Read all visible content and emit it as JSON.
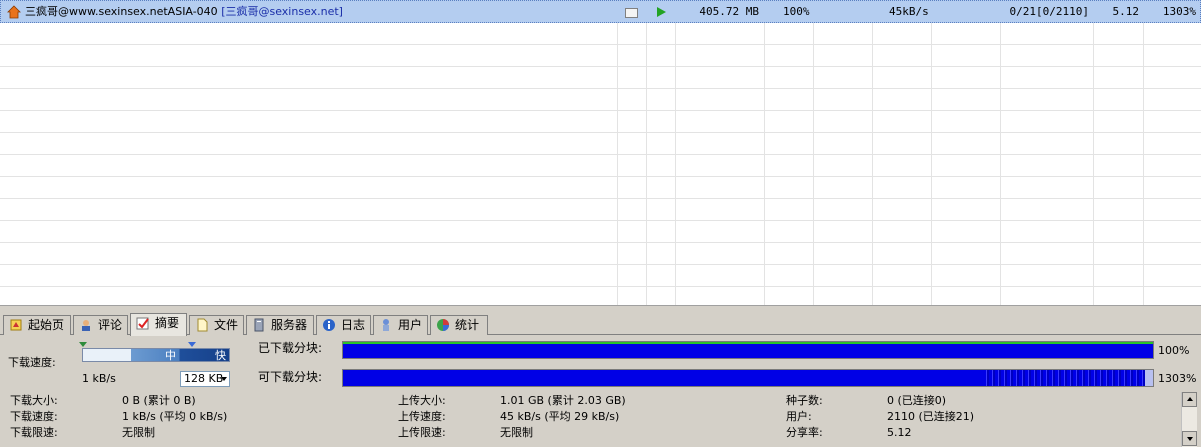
{
  "task": {
    "name": "三疯哥@www.sexinsex.netASIA-040",
    "tag": "[三疯哥@sexinsex.net]",
    "size": "405.72 MB",
    "progress": "100%",
    "speed": "45kB/s",
    "sources": "0/21[0/2110]",
    "ratio": "5.12",
    "percent": "1303%"
  },
  "tabs": [
    "起始页",
    "评论",
    "摘要",
    "文件",
    "服务器",
    "日志",
    "用户",
    "统计"
  ],
  "active_tab": "摘要",
  "summary": {
    "download_speed_label": "下载速度:",
    "speed_mid": "中",
    "speed_fast": "快",
    "current_speed": "1 kB/s",
    "limit_select": "128 KB",
    "downloaded_blocks_label": "已下载分块:",
    "downloaded_pct": "100%",
    "available_blocks_label": "可下载分块:",
    "available_pct": "1303%"
  },
  "stats": {
    "col1": [
      {
        "label": "下载大小:",
        "value": "0 B (累计 0 B)"
      },
      {
        "label": "下载速度:",
        "value": "1 kB/s (平均 0 kB/s)"
      },
      {
        "label": "下载限速:",
        "value": "无限制"
      }
    ],
    "col2": [
      {
        "label": "上传大小:",
        "value": "1.01 GB (累计 2.03 GB)"
      },
      {
        "label": "上传速度:",
        "value": "45 kB/s (平均 29 kB/s)"
      },
      {
        "label": "上传限速:",
        "value": "无限制"
      }
    ],
    "col3": [
      {
        "label": "种子数:",
        "value": "0 (已连接0)"
      },
      {
        "label": "用户:",
        "value": "2110 (已连接21)"
      },
      {
        "label": "分享率:",
        "value": "5.12"
      }
    ]
  },
  "colors": {
    "selection": "#b4cdf0",
    "bar_blue": "#0000e6",
    "bar_green": "#29c229",
    "tag_blue": "#1a2ea8"
  }
}
